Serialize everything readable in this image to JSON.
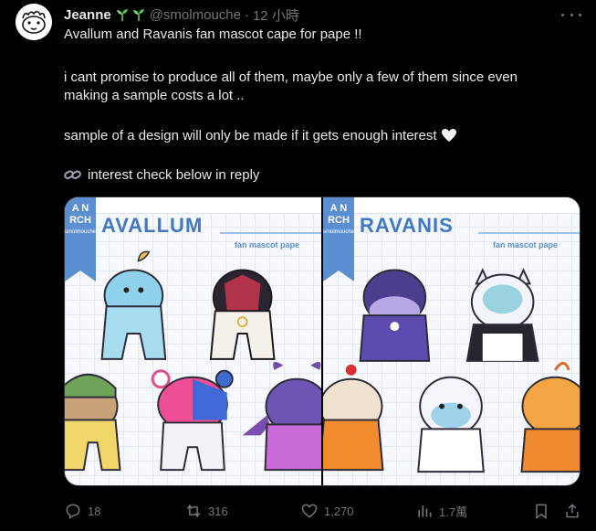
{
  "author": {
    "name": "Jeanne",
    "handle": "@smolmouche",
    "separator": "·",
    "time": "12 小時"
  },
  "tweet": {
    "lines": [
      "Avallum and Ravanis fan mascot cape for pape !!",
      "i cant promise to produce all of them, maybe only a few of them since even",
      "making a sample costs a lot ..",
      "sample of a design will only be made if it gets enough interest",
      "interest check below in reply"
    ]
  },
  "media": {
    "left": {
      "ribbon_top": "A N",
      "ribbon_mid": "RCH",
      "ribbon_small": "smolmouche",
      "title": "AVALLUM",
      "subtitle": "fan mascot pape"
    },
    "right": {
      "ribbon_top": "A N",
      "ribbon_mid": "RCH",
      "ribbon_small": "smolmouche",
      "title": "RAVANIS",
      "subtitle": "fan mascot pape"
    }
  },
  "actions": {
    "replies": "18",
    "reposts": "316",
    "likes": "1,270",
    "views": "1.7萬"
  },
  "colors": {
    "background": "#000000",
    "text": "#e7e9ea",
    "muted": "#71767b",
    "accent_blue": "#3f78c4"
  },
  "icons": [
    "sprout-icon",
    "more-icon",
    "heart-icon",
    "link-icon",
    "reply-icon",
    "repost-icon",
    "like-icon",
    "views-icon",
    "bookmark-icon",
    "share-icon"
  ]
}
